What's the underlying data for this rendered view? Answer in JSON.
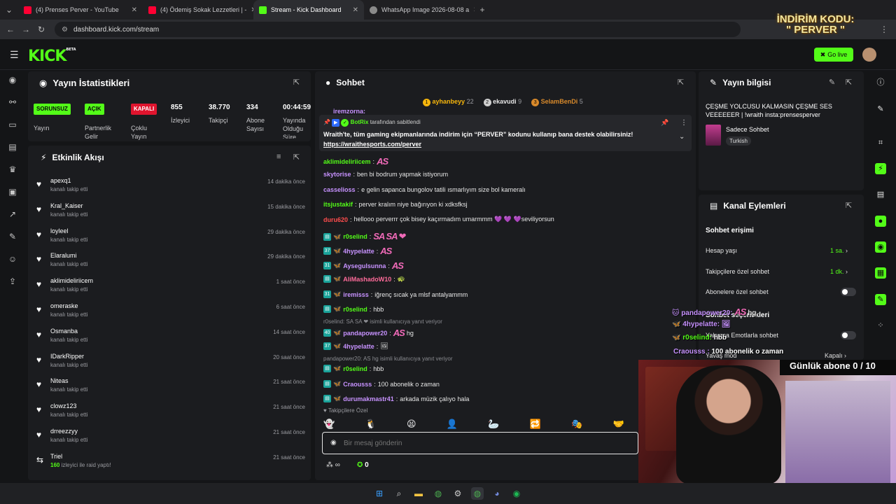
{
  "browser": {
    "tabs": [
      {
        "label": "(4) Prenses Perver - YouTube",
        "color": "#ff0033"
      },
      {
        "label": "(4) Ödemiş Sokak Lezzetleri | -",
        "color": "#ff0033"
      },
      {
        "label": "Stream - Kick Dashboard",
        "color": "#53fc18"
      },
      {
        "label": "WhatsApp Image 2026-08-08 a",
        "color": "#8a8a8a"
      }
    ],
    "url": "dashboard.kick.com/stream"
  },
  "header": {
    "logo": "KICK",
    "logo_sup": "BETA",
    "go_live": "Go live",
    "promo_line1": "İNDİRİM KODU:",
    "promo_line2": "\" PERVER \""
  },
  "stats": {
    "title": "Yayın İstatistikleri",
    "items": [
      {
        "badge": "SORUNSUZ",
        "badge_color": "#53fc18",
        "label": "Yayın"
      },
      {
        "badge": "AÇIK",
        "badge_color": "#53fc18",
        "label": "Partnerlik Gelir Programı"
      },
      {
        "badge": "KAPALI",
        "badge_color": "#e0142e",
        "label": "Çoklu Yayın"
      },
      {
        "value": "855",
        "label": "İzleyici"
      },
      {
        "value": "38.770",
        "label": "Takipçi"
      },
      {
        "value": "334",
        "label": "Abone Sayısı"
      },
      {
        "value": "00:44:59",
        "label": "Yayında Olduğu Süre"
      }
    ]
  },
  "activity": {
    "title": "Etkinlik Akışı",
    "events": [
      {
        "name": "apexq1",
        "sub": "kanalı takip etti",
        "time": "14 dakika önce"
      },
      {
        "name": "Kral_Kaiser",
        "sub": "kanalı takip etti",
        "time": "15 dakika önce"
      },
      {
        "name": "loyleel",
        "sub": "kanalı takip etti",
        "time": "29 dakika önce"
      },
      {
        "name": "Elaralumi",
        "sub": "kanalı takip etti",
        "time": "29 dakika önce"
      },
      {
        "name": "aklimideliriicem",
        "sub": "kanalı takip etti",
        "time": "1 saat önce"
      },
      {
        "name": "omeraske",
        "sub": "kanalı takip etti",
        "time": "6 saat önce"
      },
      {
        "name": "Osmanba",
        "sub": "kanalı takip etti",
        "time": "14 saat önce"
      },
      {
        "name": "IDarkRipper",
        "sub": "kanalı takip etti",
        "time": "20 saat önce"
      },
      {
        "name": "Niteas",
        "sub": "kanalı takip etti",
        "time": "21 saat önce"
      },
      {
        "name": "clowz123",
        "sub": "kanalı takip etti",
        "time": "21 saat önce"
      },
      {
        "name": "drreezzyy",
        "sub": "kanalı takip etti",
        "time": "21 saat önce"
      },
      {
        "name": "Triel",
        "sub_count": "160",
        "sub": "izleyici ile raid yaptı!",
        "time": "21 saat önce"
      }
    ]
  },
  "chat": {
    "title": "Sohbet",
    "leaders": [
      {
        "name": "ayhanbeyy",
        "count": "22",
        "color": "#f5b50c"
      },
      {
        "name": "ekavudi",
        "count": "9",
        "color": "#cfcfcf"
      },
      {
        "name": "SelamBenDi",
        "count": "5",
        "color": "#d98a2b"
      }
    ],
    "partial_top": "iremzorna:",
    "pinned": {
      "by_name": "BotRix",
      "by_text": "tarafından sabitlendi",
      "text": "Wraith'te, tüm gaming ekipmanlarında indirim için “PERVER” kodunu kullanıp bana destek olabilirsiniz!",
      "link": "https://wraithesports.com/perver"
    },
    "messages": [
      {
        "user": "aklimideliriicem",
        "color": "#53fc18",
        "text": "",
        "emote": "AS"
      },
      {
        "user": "skytorise",
        "color": "#c792ff",
        "text": "ben bi bodrum yapmak istiyorum"
      },
      {
        "user": "casselioss",
        "color": "#c792ff",
        "text": "e gelin sapanca bungolov tatili ısmarlıyım size bol kameralı"
      },
      {
        "user": "itsjustakif",
        "color": "#53fc18",
        "text": "perver kralım niye bağırıyon ki xdksfksj"
      },
      {
        "user": "duru620",
        "color": "#ff4d4d",
        "text": "hellooo perverrr çok bisey kaçırmadım umarmmm 💜 💜 💜seviliyorsun"
      },
      {
        "user": "r0selind",
        "color": "#53fc18",
        "text": "",
        "emote": "SA SA ❤"
      },
      {
        "user": "4hypelatte",
        "color": "#c792ff",
        "text": "",
        "emote": "AS",
        "badge_num": "37"
      },
      {
        "user": "Aysegulsunna",
        "color": "#c792ff",
        "text": "",
        "emote": "AS",
        "badge_num": "31"
      },
      {
        "user": "AliMashadoW10",
        "color": "#ff6b9a",
        "text": "🐢"
      },
      {
        "user": "iremisss",
        "color": "#c792ff",
        "text": "iğrenç sıcak ya mlsf antalyammm",
        "badge_num": "31"
      },
      {
        "user": "r0selind",
        "color": "#53fc18",
        "text": "hbb"
      },
      {
        "user": "pandapower20",
        "color": "#c792ff",
        "text": "hg",
        "emote": "AS",
        "badge_num": "40",
        "reply": "r0selind: SA SA ❤ isimli kullanıcıya yanıt veriyor"
      },
      {
        "user": "4hypelatte",
        "color": "#c792ff",
        "text": "🖼",
        "badge_num": "37"
      },
      {
        "user": "r0selind",
        "color": "#53fc18",
        "text": "hbb",
        "reply": "pandapower20: AS hg isimli kullanıcıya yanıt veriyor"
      },
      {
        "user": "Craousss",
        "color": "#c792ff",
        "text": "100 abonelik o zaman"
      },
      {
        "user": "durumakmastr41",
        "color": "#c792ff",
        "text": "arkada müzik çalıyo hala"
      }
    ],
    "followers_only": "Takipçilere Özel",
    "input_placeholder": "Bir mesaj gönderin",
    "points": "0"
  },
  "stream_info": {
    "title": "Yayın bilgisi",
    "stream_title": "ÇEŞME YOLCUSU KALMASIN ÇEŞME SES VEEEEEER | !wraith insta:prensesperver",
    "category": "Sadece Sohbet",
    "tag": "Turkish"
  },
  "channel_actions": {
    "title": "Kanal Eylemleri",
    "section": "Sohbet erişimi",
    "rows": [
      {
        "label": "Hesap yaşı",
        "value": "1 sa."
      },
      {
        "label": "Takipçilere özel sohbet",
        "value": "1 dk."
      },
      {
        "label": "Abonelere özel sohbet",
        "toggle": "off"
      }
    ],
    "section2": "Sohbet seçenekleri",
    "rows2": [
      {
        "label": "Yalnızca Emotlarla sohbet",
        "toggle": "off"
      },
      {
        "label": "Yavaş mod",
        "value": "Kapalı"
      }
    ]
  },
  "overlay": {
    "sub_goal": "Günlük abone 0 / 10",
    "chat": [
      {
        "user": "pandapower20",
        "text": "hg",
        "emote": "AS"
      },
      {
        "user": "4hypelatte",
        "text": "🖼"
      },
      {
        "user": "r0selind",
        "text": "hbb"
      },
      {
        "user": "Craousss",
        "text": "100 abonelik o zaman"
      }
    ]
  }
}
